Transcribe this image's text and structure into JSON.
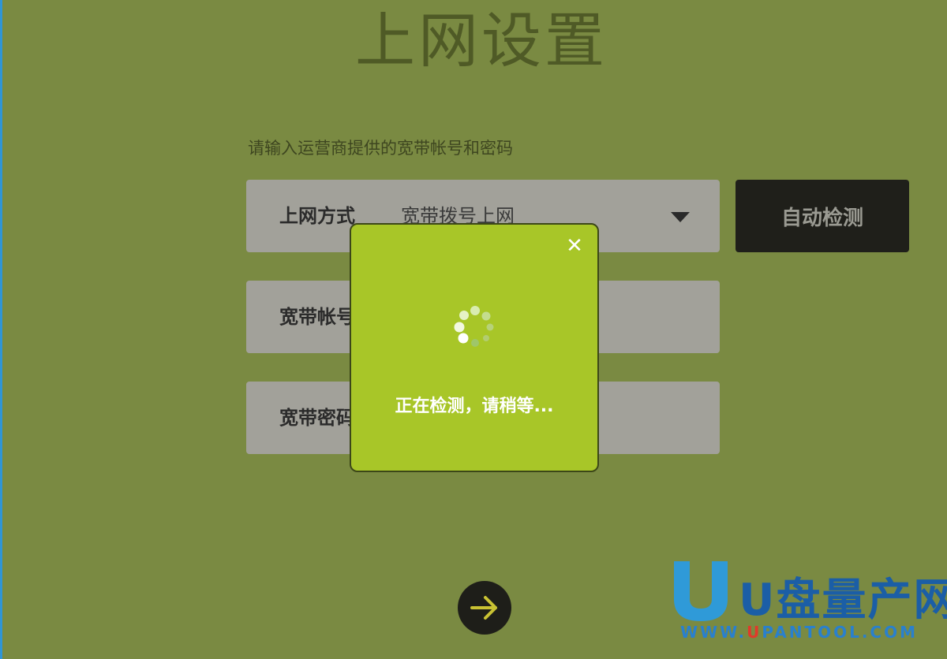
{
  "page": {
    "title": "上网设置",
    "instruction": "请输入运营商提供的宽带帐号和密码"
  },
  "form": {
    "connection_type": {
      "label": "上网方式",
      "value": "宽带拨号上网"
    },
    "account": {
      "label": "宽带帐号"
    },
    "password": {
      "label": "宽带密码"
    },
    "auto_detect_label": "自动检测"
  },
  "modal": {
    "close_symbol": "✕",
    "message": "正在检测，请稍等..."
  },
  "icons": {
    "dropdown": "chevron-down-icon",
    "next": "arrow-right-icon",
    "close": "close-icon",
    "spinner": "loading-spinner-icon"
  },
  "watermark": {
    "brand": "U盘量产网",
    "url_prefix": "WWW.",
    "url_accent": "U",
    "url_rest": "PANTOOL.COM"
  },
  "colors": {
    "background": "#7a8a42",
    "modal": "#a8c628",
    "button": "#1f1f1a",
    "field": "#a2a19a"
  }
}
